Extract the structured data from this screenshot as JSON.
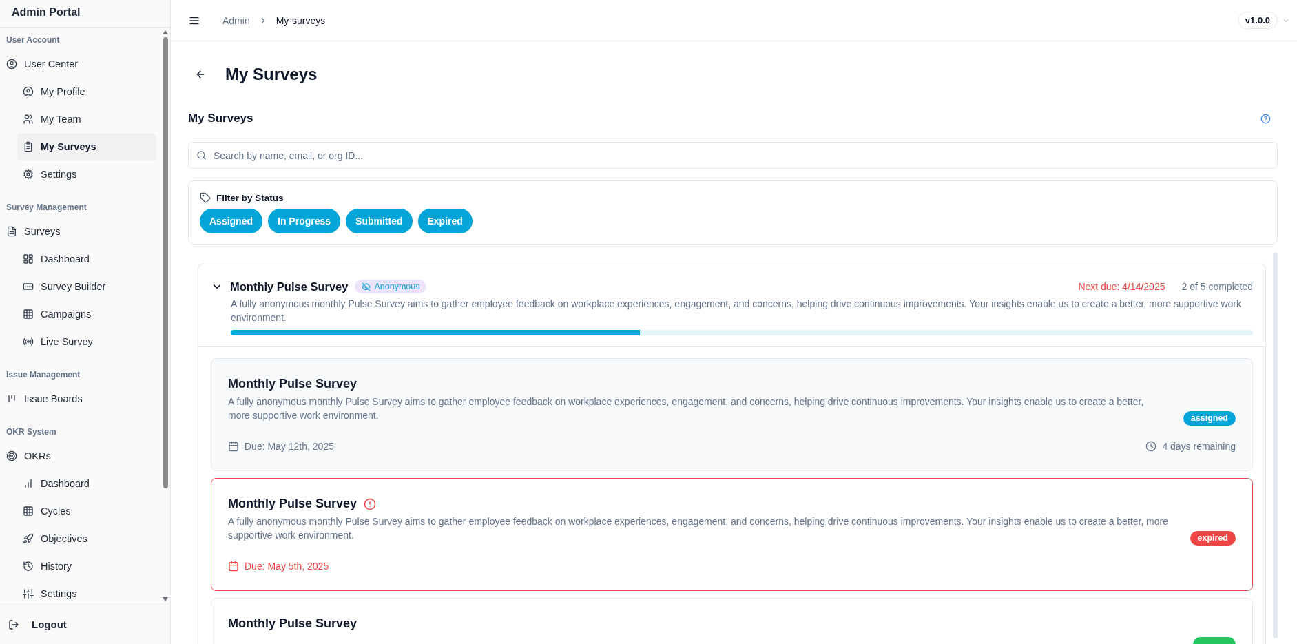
{
  "sidebar": {
    "title": "Admin Portal",
    "sections": [
      {
        "heading": "User Account",
        "items": [
          {
            "label": "User Center",
            "selected": false,
            "children": [
              {
                "label": "My Profile",
                "selected": false
              },
              {
                "label": "My Team",
                "selected": false
              },
              {
                "label": "My Surveys",
                "selected": true
              },
              {
                "label": "Settings",
                "selected": false
              }
            ]
          }
        ]
      },
      {
        "heading": "Survey Management",
        "items": [
          {
            "label": "Surveys",
            "selected": false,
            "children": [
              {
                "label": "Dashboard",
                "selected": false
              },
              {
                "label": "Survey Builder",
                "selected": false
              },
              {
                "label": "Campaigns",
                "selected": false
              },
              {
                "label": "Live Survey",
                "selected": false
              }
            ]
          }
        ]
      },
      {
        "heading": "Issue Management",
        "items": [
          {
            "label": "Issue Boards",
            "selected": false
          }
        ]
      },
      {
        "heading": "OKR System",
        "items": [
          {
            "label": "OKRs",
            "selected": false,
            "children": [
              {
                "label": "Dashboard",
                "selected": false
              },
              {
                "label": "Cycles",
                "selected": false
              },
              {
                "label": "Objectives",
                "selected": false
              },
              {
                "label": "History",
                "selected": false
              },
              {
                "label": "Settings",
                "selected": false
              }
            ]
          }
        ]
      }
    ],
    "logout": "Logout"
  },
  "topbar": {
    "breadcrumb": [
      "Admin",
      "My-surveys"
    ],
    "version": "v1.0.0"
  },
  "page": {
    "title": "My Surveys",
    "section_title": "My Surveys",
    "search": {
      "placeholder": "Search by name, email, or org ID..."
    },
    "filter": {
      "label": "Filter by Status",
      "options": [
        {
          "label": "Assigned",
          "selected": true
        },
        {
          "label": "In Progress",
          "selected": true
        },
        {
          "label": "Submitted",
          "selected": true
        },
        {
          "label": "Expired",
          "selected": true
        }
      ]
    },
    "group": {
      "title": "Monthly Pulse Survey",
      "expanded": true,
      "badge": "Anonymous",
      "description": "A fully anonymous monthly Pulse Survey aims to gather employee feedback on workplace experiences, engagement, and concerns, helping drive continuous improvements. Your insights enable us to create a better, more supportive work environment.",
      "next_due": "Next due: 4/14/2025",
      "progress_text": "2 of 5 completed",
      "level": 0.4,
      "cards": [
        {
          "title": "Monthly Pulse Survey",
          "overdue": false,
          "description": "A fully anonymous monthly Pulse Survey aims to gather employee feedback on workplace experiences, engagement, and concerns, helping drive continuous improvements. Your insights enable us to create a better, more supportive work environment.",
          "due": "Due: May 12th, 2025",
          "status": "assigned",
          "color": "#06a6d9",
          "remaining": "4 days remaining"
        },
        {
          "title": "Monthly Pulse Survey",
          "overdue": true,
          "description": "A fully anonymous monthly Pulse Survey aims to gather employee feedback on workplace experiences, engagement, and concerns, helping drive continuous improvements. Your insights enable us to create a better, more supportive work environment.",
          "due": "Due: May 5th, 2025",
          "status": "expired",
          "color": "#ef4444"
        },
        {
          "title": "Monthly Pulse Survey",
          "overdue": false,
          "color": "#22c55e"
        }
      ]
    }
  }
}
